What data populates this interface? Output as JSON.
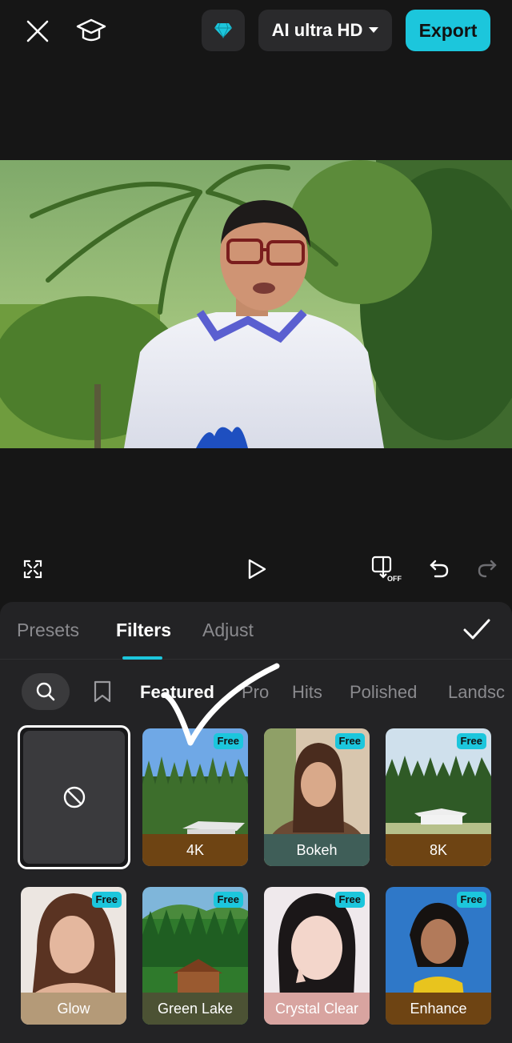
{
  "header": {
    "quality_label": "AI ultra HD",
    "export_label": "Export"
  },
  "panel": {
    "tabs": [
      "Presets",
      "Filters",
      "Adjust"
    ],
    "active_tab": "Filters"
  },
  "categories": [
    "Featured",
    "Pro",
    "Hits",
    "Polished",
    "Landsc"
  ],
  "active_category": "Featured",
  "filters": [
    {
      "label": "4K",
      "badge": "Free"
    },
    {
      "label": "Bokeh",
      "badge": "Free"
    },
    {
      "label": "8K",
      "badge": "Free"
    },
    {
      "label": "Glow",
      "badge": "Free"
    },
    {
      "label": "Green Lake",
      "badge": "Free"
    },
    {
      "label": "Crystal Clear",
      "badge": "Free"
    },
    {
      "label": "Enhance",
      "badge": "Free"
    }
  ],
  "colors": {
    "accent": "#1cc6dc",
    "panel_bg": "#232325",
    "app_bg": "#161616"
  }
}
